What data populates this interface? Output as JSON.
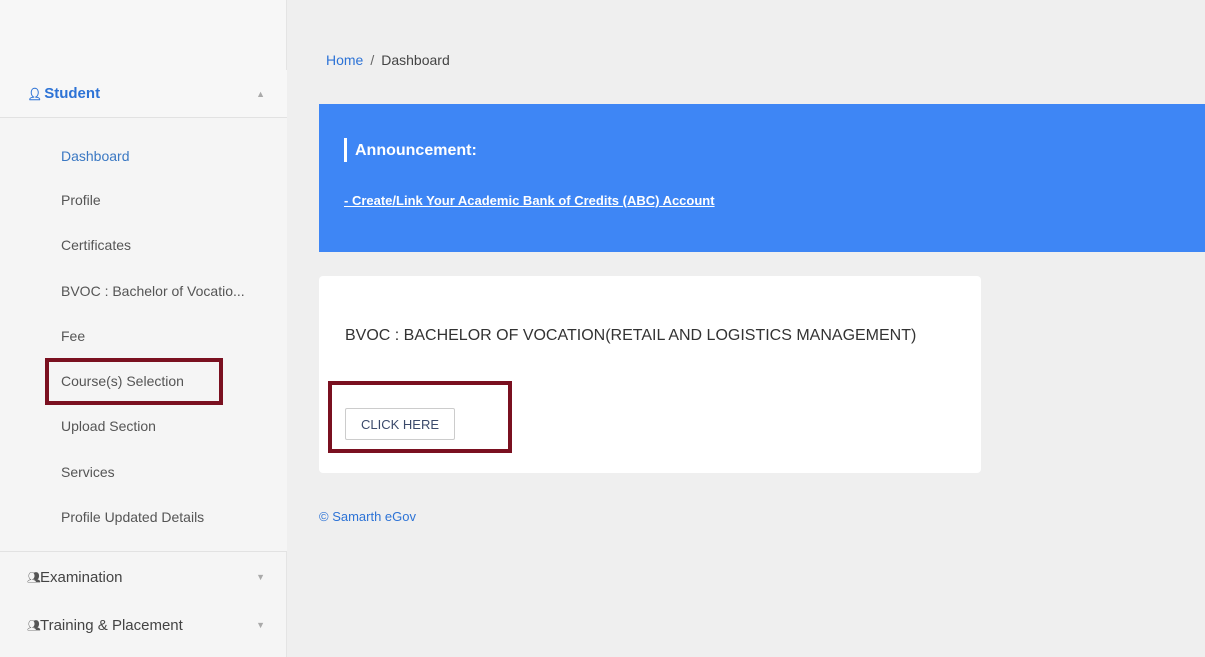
{
  "sidebar": {
    "student_label": "Student",
    "student_icon": "user-icon",
    "items": [
      {
        "label": "Dashboard"
      },
      {
        "label": "Profile"
      },
      {
        "label": "Certificates"
      },
      {
        "label": "BVOC : Bachelor of Vocatio..."
      },
      {
        "label": "Fee"
      },
      {
        "label": "Course(s) Selection"
      },
      {
        "label": "Upload Section"
      },
      {
        "label": "Services"
      },
      {
        "label": "Profile Updated Details"
      }
    ],
    "examination_label": "Examination",
    "training_label": "Training & Placement",
    "group_icon": "users-icon"
  },
  "breadcrumb": {
    "home": "Home",
    "separator": "/",
    "current": "Dashboard"
  },
  "announcement": {
    "title": "Announcement:",
    "link": "- Create/Link Your Academic Bank of Credits (ABC) Account",
    "background": "#3e86f5"
  },
  "course": {
    "title": "BVOC : BACHELOR OF VOCATION(RETAIL AND LOGISTICS MANAGEMENT)",
    "button_label": "CLICK HERE"
  },
  "footer": {
    "text": "© Samarth eGov"
  },
  "colors": {
    "link_blue": "#2d73d6",
    "highlight": "#7a1020"
  }
}
